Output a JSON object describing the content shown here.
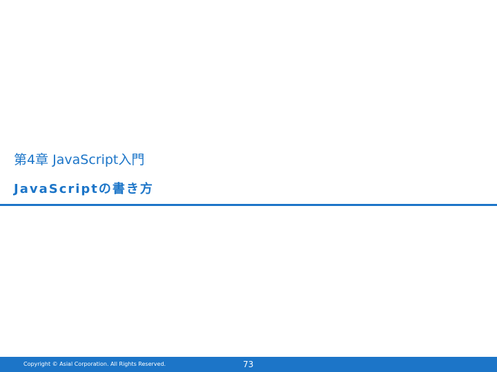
{
  "slide": {
    "chapter_title": "第4章 JavaScript入門",
    "section_title": "JavaScriptの書き方",
    "accent_color": "#1c75c8"
  },
  "footer": {
    "copyright": "Copyright © Asial Corporation. All Rights Reserved.",
    "page_number": "73"
  }
}
